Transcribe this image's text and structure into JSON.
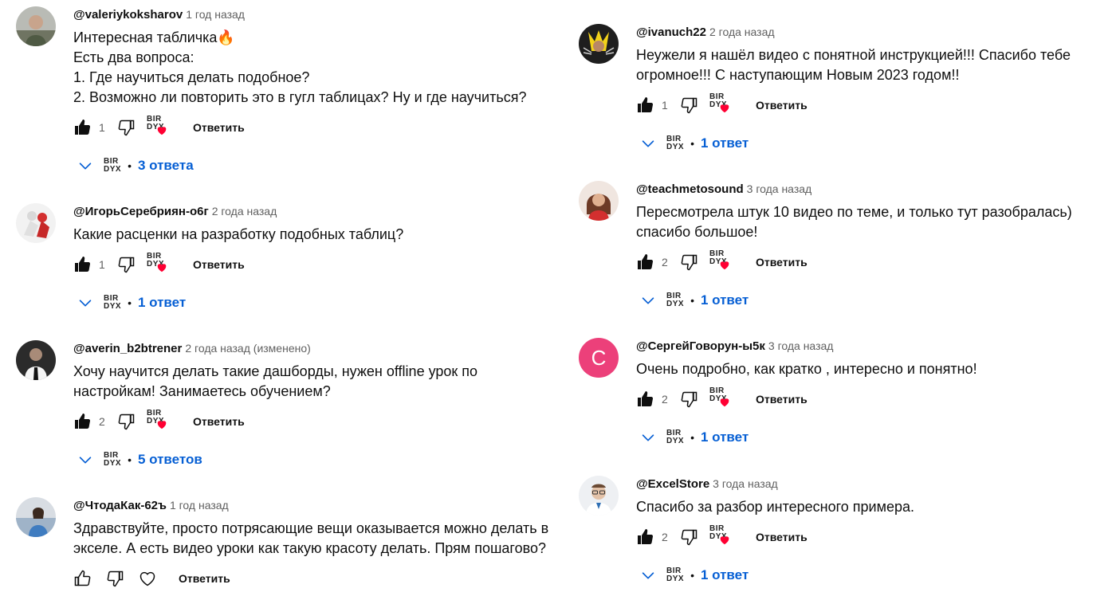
{
  "ui": {
    "reply_label": "Ответить",
    "channel_logo": [
      "BIR",
      "DYX"
    ],
    "accent": "#065fd4",
    "heart_color": "#ff0033"
  },
  "left": [
    {
      "author": "@valeriykoksharov",
      "time": "1 год назад",
      "lines": [
        "Интересная табличка🔥",
        "Есть два вопроса:",
        "1. Где научиться делать подобное?",
        "2. Возможно ли повторить это в гугл таблицах? Ну и где научиться?"
      ],
      "likes": "1",
      "replies": "3 ответа",
      "avatar": "photo-man-grey"
    },
    {
      "author": "@ИгорьСеребриян-о6г",
      "time": "2 года назад",
      "lines": [
        "Какие расценки на разработку подобных таблиц?"
      ],
      "likes": "1",
      "replies": "1 ответ",
      "avatar": "photo-figure-red"
    },
    {
      "author": "@averin_b2btrener",
      "time": "2 года назад (изменено)",
      "lines": [
        "Хочу  научится делать такие дашборды, нужен offline  урок по",
        "настройкам! Занимаетесь обучением?"
      ],
      "likes": "2",
      "replies": "5 ответов",
      "avatar": "photo-man-dark"
    },
    {
      "author": "@ЧтодаКак-62ъ",
      "time": "1 год назад",
      "lines": [
        "Здравствуйте, просто потрясающие вещи оказывается можно делать в",
        "экселе. А есть видео уроки как такую красоту делать. Прям пошагово?"
      ],
      "likes": "",
      "replies": "",
      "avatar": "photo-woman-blue"
    }
  ],
  "right": [
    {
      "author": "@ivanuch22",
      "time": "2 года назад",
      "lines": [
        "Неужели я нашёл видео с понятной инструкцией!!! Спасибо тебе",
        "огромное!!! С наступающим Новым 2023 годом!!"
      ],
      "likes": "1",
      "replies": "1 ответ",
      "avatar": "photo-wolverine"
    },
    {
      "author": "@teachmetosound",
      "time": "3 года назад",
      "lines": [
        "Пересмотрела штук 10 видео по теме, и только тут разобралась)",
        "спасибо большое!"
      ],
      "likes": "2",
      "replies": "1 ответ",
      "avatar": "photo-woman-red"
    },
    {
      "author": "@СергейГоворун-ы5к",
      "time": "3 года назад",
      "lines": [
        "Очень подробно, как кратко , интересно и понятно!"
      ],
      "likes": "2",
      "replies": "1 ответ",
      "avatar": "letter",
      "avatar_letter": "С",
      "avatar_color": "#ec407a"
    },
    {
      "author": "@ExcelStore",
      "time": "3 года назад",
      "lines": [
        "Спасибо за разбор интересного примера."
      ],
      "likes": "2",
      "replies": "1 ответ",
      "avatar": "photo-man-glasses"
    }
  ]
}
